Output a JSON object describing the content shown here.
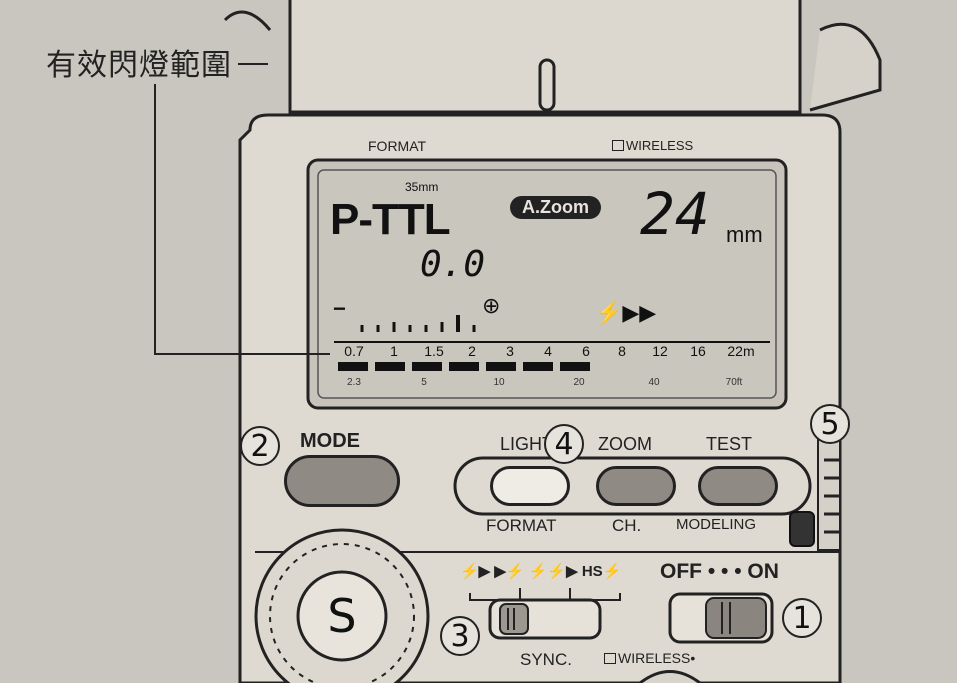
{
  "callout": {
    "label": "有效閃燈範圍"
  },
  "panel": {
    "format_top": "FORMAT",
    "wireless_top": "WIRELESS"
  },
  "lcd": {
    "focal_small": "35mm",
    "mode": "P-TTL",
    "zoom_badge": "A.Zoom",
    "focal_value": "24",
    "focal_unit": "mm",
    "compensation": "0.0",
    "minus_sign": "−",
    "plus_sign": "⊕",
    "flash_icon": "⚡▶▶",
    "range_m": [
      "0.7",
      "1",
      "1.5",
      "2",
      "3",
      "4",
      "6",
      "8",
      "12",
      "16",
      "22m"
    ],
    "range_ft": [
      "2.3",
      "5",
      "10",
      "20",
      "40",
      "70ft"
    ]
  },
  "buttons": {
    "mode": "MODE",
    "light": "LIGHT",
    "zoom": "ZOOM",
    "test": "TEST",
    "format": "FORMAT",
    "ch": "CH.",
    "modeling": "MODELING"
  },
  "switches": {
    "sync_icons": "⚡▶ ▶⚡ ⚡⚡▶ HS⚡",
    "power_label": "OFF • • • ON",
    "sync": "SYNC.",
    "wireless_bottom": "WIRELESS•",
    "dial_letter": "S"
  },
  "callouts": {
    "n1": "1",
    "n2": "2",
    "n3": "3",
    "n4": "4",
    "n5": "5"
  }
}
